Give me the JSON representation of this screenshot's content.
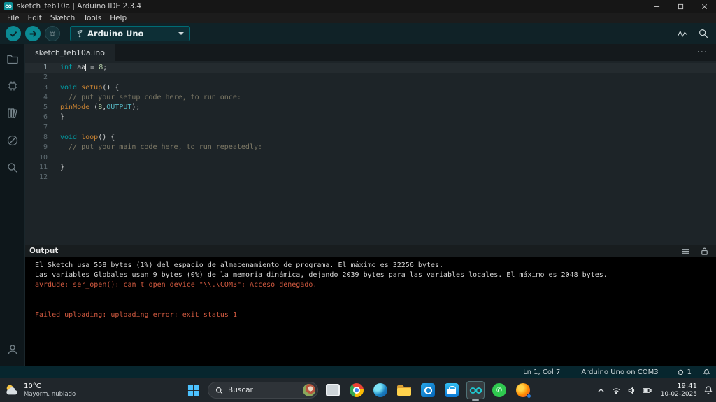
{
  "window": {
    "title": "sketch_feb10a | Arduino IDE 2.3.4"
  },
  "menu": {
    "items": [
      "File",
      "Edit",
      "Sketch",
      "Tools",
      "Help"
    ]
  },
  "toolbar": {
    "board_selector_label": "Arduino Uno"
  },
  "tabbar": {
    "active_tab": "sketch_feb10a.ino"
  },
  "editor": {
    "active_line": 1,
    "lines": [
      {
        "num": "1",
        "tokens": [
          {
            "c": "kw",
            "s": "int"
          },
          {
            "c": "pl",
            "s": " aa"
          },
          {
            "c": "cursor",
            "s": ""
          },
          {
            "c": "pl",
            "s": " = "
          },
          {
            "c": "num",
            "s": "8"
          },
          {
            "c": "pl",
            "s": ";"
          }
        ]
      },
      {
        "num": "2",
        "tokens": []
      },
      {
        "num": "3",
        "tokens": [
          {
            "c": "kw",
            "s": "void"
          },
          {
            "c": "pl",
            "s": " "
          },
          {
            "c": "fn",
            "s": "setup"
          },
          {
            "c": "pl",
            "s": "() {"
          }
        ]
      },
      {
        "num": "4",
        "tokens": [
          {
            "c": "cm",
            "s": "  // put your setup code here, to run once:"
          }
        ]
      },
      {
        "num": "5",
        "tokens": [
          {
            "c": "fn",
            "s": "pinMode"
          },
          {
            "c": "pl",
            "s": " ("
          },
          {
            "c": "num",
            "s": "8"
          },
          {
            "c": "pl",
            "s": ","
          },
          {
            "c": "cn",
            "s": "OUTPUT"
          },
          {
            "c": "pl",
            "s": ");"
          }
        ]
      },
      {
        "num": "6",
        "tokens": [
          {
            "c": "pl",
            "s": "}"
          }
        ]
      },
      {
        "num": "7",
        "tokens": []
      },
      {
        "num": "8",
        "tokens": [
          {
            "c": "kw",
            "s": "void"
          },
          {
            "c": "pl",
            "s": " "
          },
          {
            "c": "fn",
            "s": "loop"
          },
          {
            "c": "pl",
            "s": "() {"
          }
        ]
      },
      {
        "num": "9",
        "tokens": [
          {
            "c": "cm",
            "s": "  // put your main code here, to run repeatedly:"
          }
        ]
      },
      {
        "num": "10",
        "tokens": []
      },
      {
        "num": "11",
        "tokens": [
          {
            "c": "pl",
            "s": "}"
          }
        ]
      },
      {
        "num": "12",
        "tokens": []
      }
    ]
  },
  "output": {
    "title": "Output",
    "lines": [
      {
        "type": "info",
        "text": "El Sketch usa 558 bytes (1%) del espacio de almacenamiento de programa. El máximo es 32256 bytes."
      },
      {
        "type": "info",
        "text": "Las variables Globales usan 9 bytes (0%) de la memoria dinámica, dejando 2039 bytes para las variables locales. El máximo es 2048 bytes."
      },
      {
        "type": "error",
        "text": "avrdude: ser_open(): can't open device \"\\\\.\\COM3\": Acceso denegado."
      },
      {
        "type": "info",
        "text": ""
      },
      {
        "type": "info",
        "text": ""
      },
      {
        "type": "error",
        "text": "Failed uploading: uploading error: exit status 1"
      }
    ]
  },
  "statusbar": {
    "position": "Ln 1, Col 7",
    "board": "Arduino Uno on COM3",
    "notification_count": "1"
  },
  "taskbar": {
    "weather": {
      "temperature": "10°C",
      "condition": "Mayorm. nublado"
    },
    "search_placeholder": "Buscar",
    "clock": {
      "time": "19:41",
      "date": "10-02-2025"
    }
  },
  "colors": {
    "accent_teal": "#0b8a93",
    "error_text": "#d25a40",
    "editor_background": "#1d2428",
    "console_background": "#000000"
  }
}
